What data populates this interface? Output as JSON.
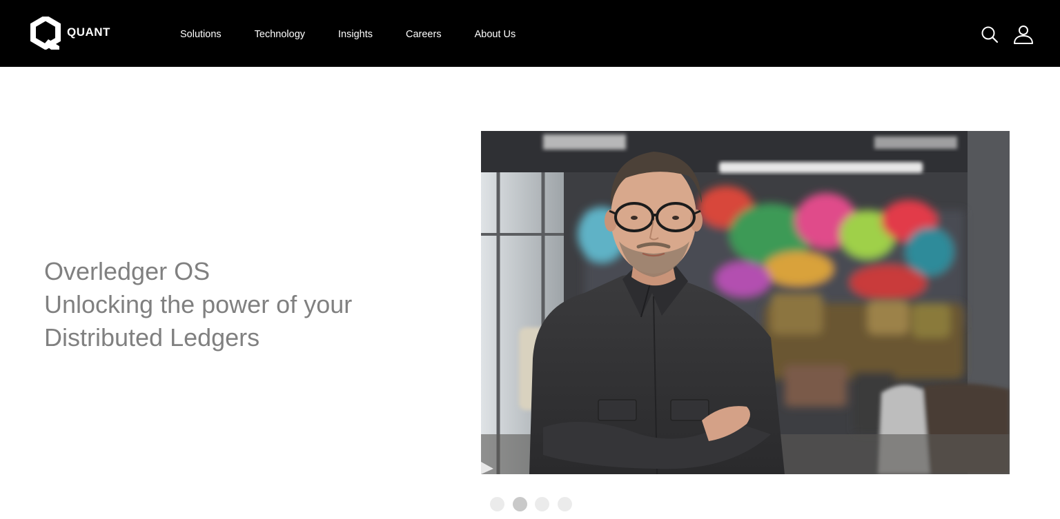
{
  "header": {
    "logo_text": "QUANT",
    "nav": [
      {
        "label": "Solutions"
      },
      {
        "label": "Technology"
      },
      {
        "label": "Insights"
      },
      {
        "label": "Careers"
      },
      {
        "label": "About Us"
      }
    ],
    "search_icon": "search-icon",
    "account_icon": "user-icon"
  },
  "hero": {
    "lines": [
      "Overledger OS",
      "Unlocking the power of your",
      "Distributed Ledgers"
    ]
  },
  "carousel": {
    "slide_count": 4,
    "active_index": 1
  },
  "colors": {
    "header_bg": "#000000",
    "header_text": "#ffffff",
    "hero_text": "#808080",
    "dot_inactive": "#ebebeb",
    "dot_active": "#c9c9c9"
  }
}
